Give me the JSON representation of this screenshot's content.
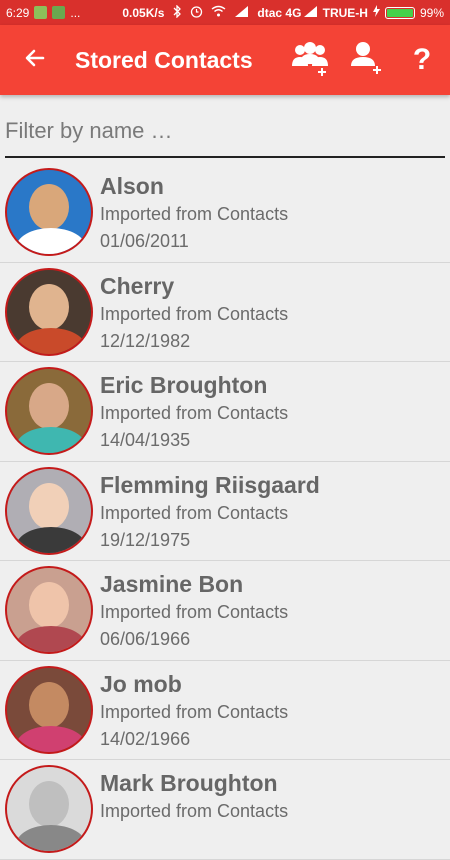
{
  "status": {
    "time": "6:29",
    "dots": "...",
    "speed": "0.05K/s",
    "carrier1": "dtac 4G",
    "carrier2": "TRUE-H",
    "battery": "99%",
    "battery_level": 0.99
  },
  "appbar": {
    "title": "Stored Contacts",
    "back_icon": "arrow-back-icon",
    "actions": [
      {
        "icon": "group-add-icon"
      },
      {
        "icon": "person-add-icon"
      },
      {
        "icon": "help-icon",
        "glyph": "?"
      }
    ]
  },
  "filter": {
    "placeholder": "Filter by name …",
    "value": ""
  },
  "contacts": [
    {
      "name": "Alson",
      "source": "Imported from Contacts",
      "date": "01/06/2011",
      "bg": "#2a78c8",
      "skin": "#d9a77a",
      "shirt": "#ffffff"
    },
    {
      "name": "Cherry",
      "source": "Imported from Contacts",
      "date": "12/12/1982",
      "bg": "#4a3a30",
      "skin": "#e0b48f",
      "shirt": "#c94a2a"
    },
    {
      "name": "Eric Broughton",
      "source": "Imported from Contacts",
      "date": "14/04/1935",
      "bg": "#8a6a3a",
      "skin": "#d8a888",
      "shirt": "#3fb7b0"
    },
    {
      "name": "Flemming Riisgaard",
      "source": "Imported from Contacts",
      "date": "19/12/1975",
      "bg": "#b0aeb4",
      "skin": "#f1d0b8",
      "shirt": "#3a3a3a"
    },
    {
      "name": "Jasmine Bon",
      "source": "Imported from Contacts",
      "date": "06/06/1966",
      "bg": "#c9a090",
      "skin": "#efc4aa",
      "shirt": "#b04850"
    },
    {
      "name": "Jo mob",
      "source": "Imported from Contacts",
      "date": "14/02/1966",
      "bg": "#7a4a3a",
      "skin": "#c48a62",
      "shirt": "#d04070"
    },
    {
      "name": "Mark Broughton",
      "source": "Imported from Contacts",
      "date": "",
      "bg": "#dadada",
      "skin": "#bfbfbf",
      "shirt": "#888888"
    }
  ]
}
